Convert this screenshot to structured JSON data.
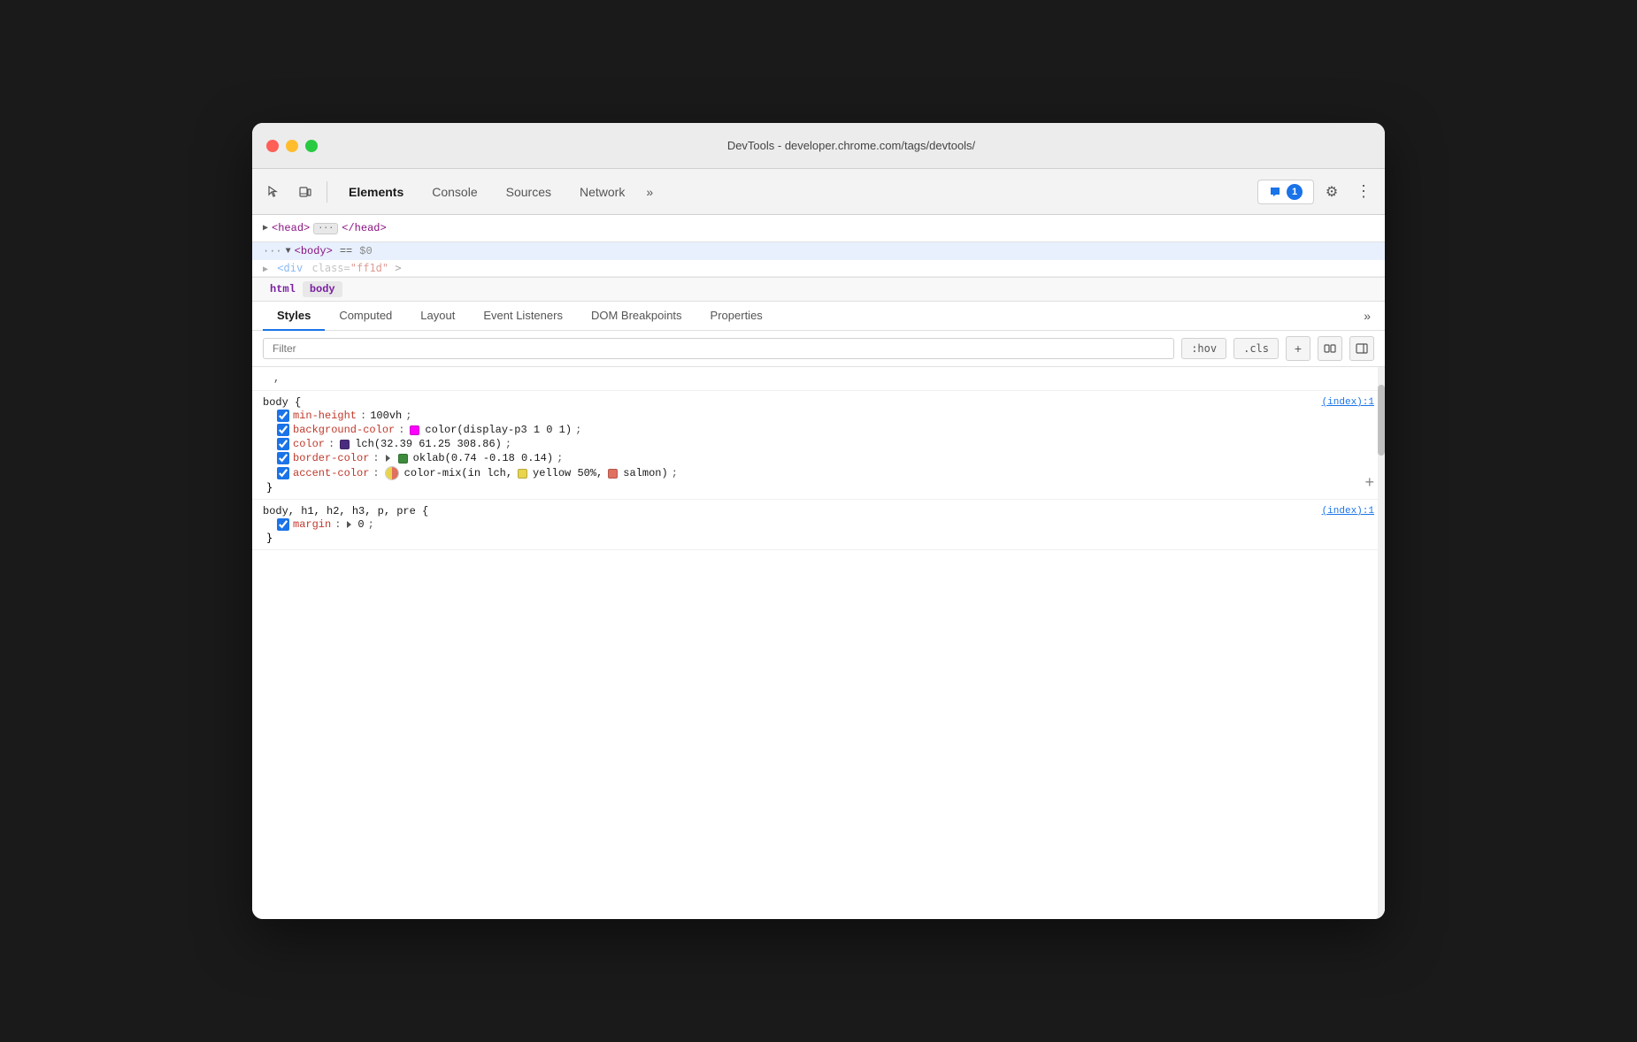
{
  "window": {
    "title": "DevTools - developer.chrome.com/tags/devtools/"
  },
  "toolbar": {
    "tabs": [
      "Elements",
      "Console",
      "Sources",
      "Network"
    ],
    "more_label": "»",
    "feedback_label": "1",
    "settings_icon": "⚙",
    "more_icon": "⋮"
  },
  "html_tree": {
    "head_line": "▶ <head>  </head>",
    "body_line": "··· ▼ <body>  == $0",
    "partial_line": "▶ <div  class=\"ff1d\"  >"
  },
  "breadcrumb": {
    "items": [
      "html",
      "body"
    ]
  },
  "css_panel": {
    "tabs": [
      "Styles",
      "Computed",
      "Layout",
      "Event Listeners",
      "DOM Breakpoints",
      "Properties"
    ],
    "active_tab": "Styles",
    "filter_placeholder": "Filter",
    "filter_buttons": [
      ":hov",
      ".cls"
    ],
    "add_icon": "+",
    "rules": [
      {
        "id": "comma_line",
        "content": ","
      },
      {
        "selector": "body {",
        "source": "(index):1",
        "properties": [
          {
            "enabled": true,
            "name": "min-height",
            "colon": ":",
            "value": "100vh",
            "semicolon": ";"
          },
          {
            "enabled": true,
            "name": "background-color",
            "colon": ":",
            "swatch_type": "solid",
            "swatch_color": "#ff00ff",
            "value": "color(display-p3 1 0 1)",
            "semicolon": ";"
          },
          {
            "enabled": true,
            "name": "color",
            "colon": ":",
            "swatch_type": "solid",
            "swatch_color": "#4b2d7f",
            "value": "lch(32.39 61.25 308.86)",
            "semicolon": ";"
          },
          {
            "enabled": true,
            "name": "border-color",
            "colon": ":",
            "has_arrow": true,
            "swatch_type": "solid",
            "swatch_color": "#3a7a3a",
            "value": "oklab(0.74 -0.18 0.14)",
            "semicolon": ";"
          },
          {
            "enabled": true,
            "name": "accent-color",
            "colon": ":",
            "swatch_type": "split",
            "swatch_left": "#e8c840",
            "swatch_right": "#e07060",
            "value_parts": [
              "color-mix(in lch, ",
              "yellow",
              " 50%, ",
              "salmon",
              ")"
            ],
            "swatch_yellow": "#e8d44d",
            "swatch_salmon": "#e07060",
            "semicolon": ";"
          }
        ],
        "close": "}"
      },
      {
        "selector": "body, h1, h2, h3, p, pre {",
        "source": "(index):1",
        "properties": [
          {
            "enabled": true,
            "has_arrow": true,
            "name": "margin",
            "colon": ":",
            "value": "0",
            "semicolon": ";"
          }
        ],
        "close": "}"
      }
    ]
  }
}
